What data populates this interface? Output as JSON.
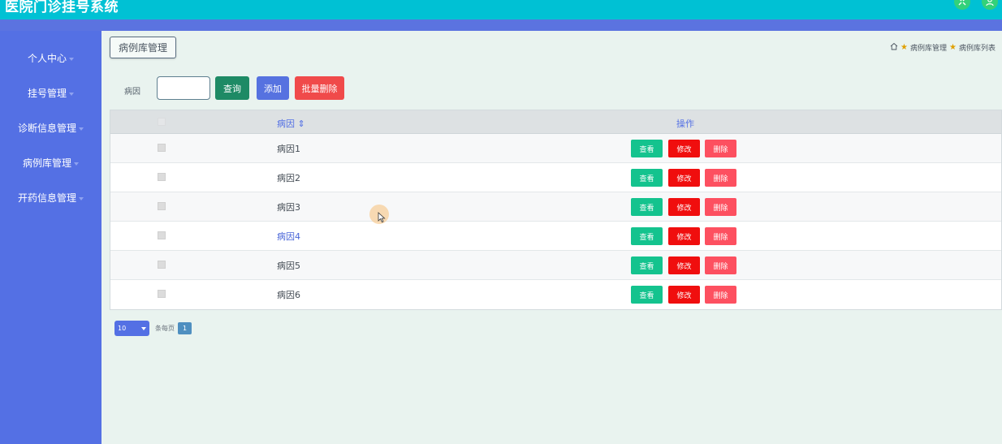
{
  "app": {
    "title": "医院门诊挂号系统"
  },
  "header_icons": [
    "shrink-icon",
    "user-icon"
  ],
  "sidebar": {
    "items": [
      {
        "label": "个人中心"
      },
      {
        "label": "挂号管理"
      },
      {
        "label": "诊断信息管理"
      },
      {
        "label": "病例库管理"
      },
      {
        "label": "开药信息管理"
      }
    ]
  },
  "page": {
    "tab_label": "病例库管理",
    "breadcrumb": [
      "病例库管理",
      "病例库列表"
    ]
  },
  "filter": {
    "label": "病因",
    "value": "",
    "query_button": "查询",
    "add_button": "添加",
    "batch_delete_button": "批量删除"
  },
  "table": {
    "columns": {
      "name": "病因 ⇕",
      "actions": "操作"
    },
    "rows": [
      {
        "name": "病因1",
        "view": "查看",
        "edit": "修改",
        "delete": "删除"
      },
      {
        "name": "病因2",
        "view": "查看",
        "edit": "修改",
        "delete": "删除"
      },
      {
        "name": "病因3",
        "view": "查看",
        "edit": "修改",
        "delete": "删除"
      },
      {
        "name": "病因4",
        "view": "查看",
        "edit": "修改",
        "delete": "删除"
      },
      {
        "name": "病因5",
        "view": "查看",
        "edit": "修改",
        "delete": "删除"
      },
      {
        "name": "病因6",
        "view": "查看",
        "edit": "修改",
        "delete": "删除"
      }
    ]
  },
  "pagination": {
    "page_size": "10",
    "per_page_text": "条每页",
    "current_page": "1"
  },
  "colors": {
    "topbar": "#00c1d4",
    "sidebar": "#5470e4",
    "main_bg": "#e9f3ef",
    "view_button": "#14c38e",
    "edit_button": "#f00e0e",
    "delete_button": "#fd5060"
  }
}
